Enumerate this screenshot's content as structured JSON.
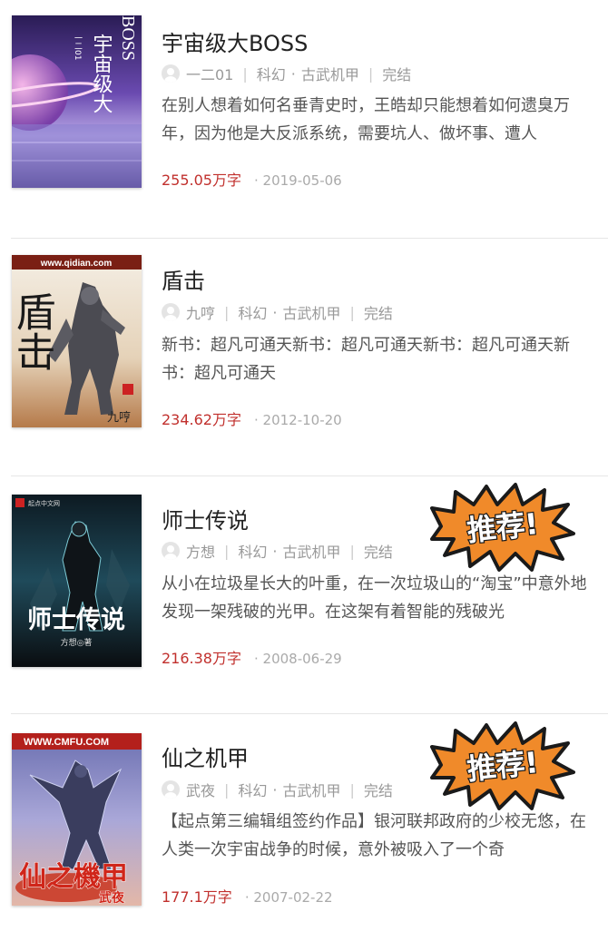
{
  "books": [
    {
      "title": "宇宙级大BOSS",
      "author": "一二01",
      "category": "科幻",
      "subcategory": "古武机甲",
      "status": "完结",
      "description": "在别人想着如何名垂青史时，王皓却只能想着如何遗臭万年，因为他是大反派系统，需要坑人、做坏事、遭人",
      "word_count": "255.05万字",
      "date": "2019-05-06",
      "recommended": false
    },
    {
      "title": "盾击",
      "author": "九哼",
      "category": "科幻",
      "subcategory": "古武机甲",
      "status": "完结",
      "description": "新书：超凡可通天新书：超凡可通天新书：超凡可通天新书：超凡可通天",
      "word_count": "234.62万字",
      "date": "2012-10-20",
      "recommended": false
    },
    {
      "title": "师士传说",
      "author": "方想",
      "category": "科幻",
      "subcategory": "古武机甲",
      "status": "完结",
      "description": "从小在垃圾星长大的叶重，在一次垃圾山的“淘宝”中意外地发现一架残破的光甲。在这架有着智能的残破光",
      "word_count": "216.38万字",
      "date": "2008-06-29",
      "recommended": true
    },
    {
      "title": "仙之机甲",
      "author": "武夜",
      "category": "科幻",
      "subcategory": "古武机甲",
      "status": "完结",
      "description": "【起点第三编辑组签约作品】银河联邦政府的少校无悠，在人类一次宇宙战争的时候，意外被吸入了一个奇",
      "word_count": "177.1万字",
      "date": "2007-02-22",
      "recommended": true
    }
  ],
  "badge_text": "推荐!",
  "cover_texts": {
    "cover1_top": "BOSS",
    "cover1_main": "宇宙级大",
    "cover1_author": "一二01",
    "cover2_url": "www.qidian.com",
    "cover2_main": "盾击",
    "cover2_author": "九哼",
    "cover3_publisher": "起点中文网",
    "cover3_main": "师士传说",
    "cover3_author": "方想◎著",
    "cover4_url": "WWW.CMFU.COM",
    "cover4_main": "仙之機甲",
    "cover4_author": "武夜"
  },
  "colors": {
    "word_count": "#c1302d",
    "badge_fill": "#f08a2a",
    "badge_outline": "#1a1a1a",
    "meta": "#999999"
  }
}
